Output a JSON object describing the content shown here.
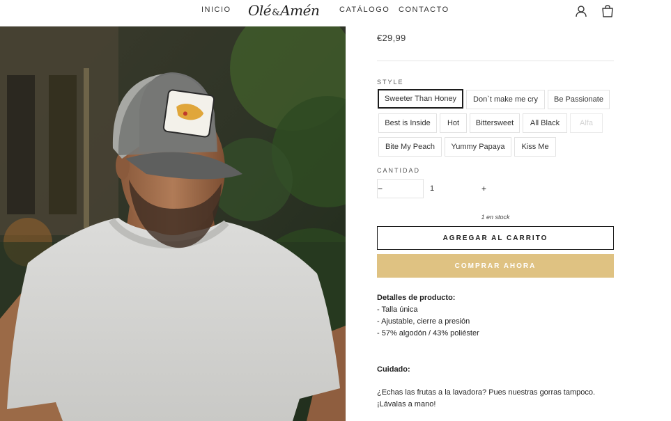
{
  "header": {
    "nav_left": [
      "INICIO"
    ],
    "logo": {
      "part1": "Olé",
      "amp": "&",
      "part2": "Amén"
    },
    "nav_right": [
      "CATÁLOGO",
      "CONTACTO"
    ],
    "icons": [
      "account-icon",
      "cart-icon"
    ]
  },
  "product": {
    "image_label": "SWEETER THAN HONEY",
    "price": "€29,99",
    "style_label": "STYLE",
    "styles": [
      {
        "label": "Sweeter Than Honey",
        "selected": true,
        "available": true
      },
      {
        "label": "Don`t make me cry",
        "selected": false,
        "available": true
      },
      {
        "label": "Be Passionate",
        "selected": false,
        "available": true
      },
      {
        "label": "Best is Inside",
        "selected": false,
        "available": true
      },
      {
        "label": "Hot",
        "selected": false,
        "available": true
      },
      {
        "label": "Bittersweet",
        "selected": false,
        "available": true
      },
      {
        "label": "All Black",
        "selected": false,
        "available": true
      },
      {
        "label": "Alfa",
        "selected": false,
        "available": false
      },
      {
        "label": "Bite My Peach",
        "selected": false,
        "available": true
      },
      {
        "label": "Yummy Papaya",
        "selected": false,
        "available": true
      },
      {
        "label": "Kiss Me",
        "selected": false,
        "available": true
      }
    ],
    "quantity_label": "CANTIDAD",
    "quantity": {
      "minus": "−",
      "value": "1",
      "plus": "+"
    },
    "stock": "1 en stock",
    "add_to_cart": "AGREGAR AL CARRITO",
    "buy_now": "COMPRAR AHORA",
    "details_title": "Detalles de producto:",
    "details": [
      "- Talla única",
      "- Ajustable, cierre a presión",
      "- 57% algodón / 43% poliéster"
    ],
    "care_title": "Cuidado:",
    "care_lines": [
      "¿Echas las frutas a la lavadora? Pues nuestras gorras tampoco.",
      "¡Lávalas a mano!"
    ]
  },
  "colors": {
    "buy_now_bg": "#dfc282",
    "text": "#1c1c1c",
    "border": "#e2e2e2"
  }
}
